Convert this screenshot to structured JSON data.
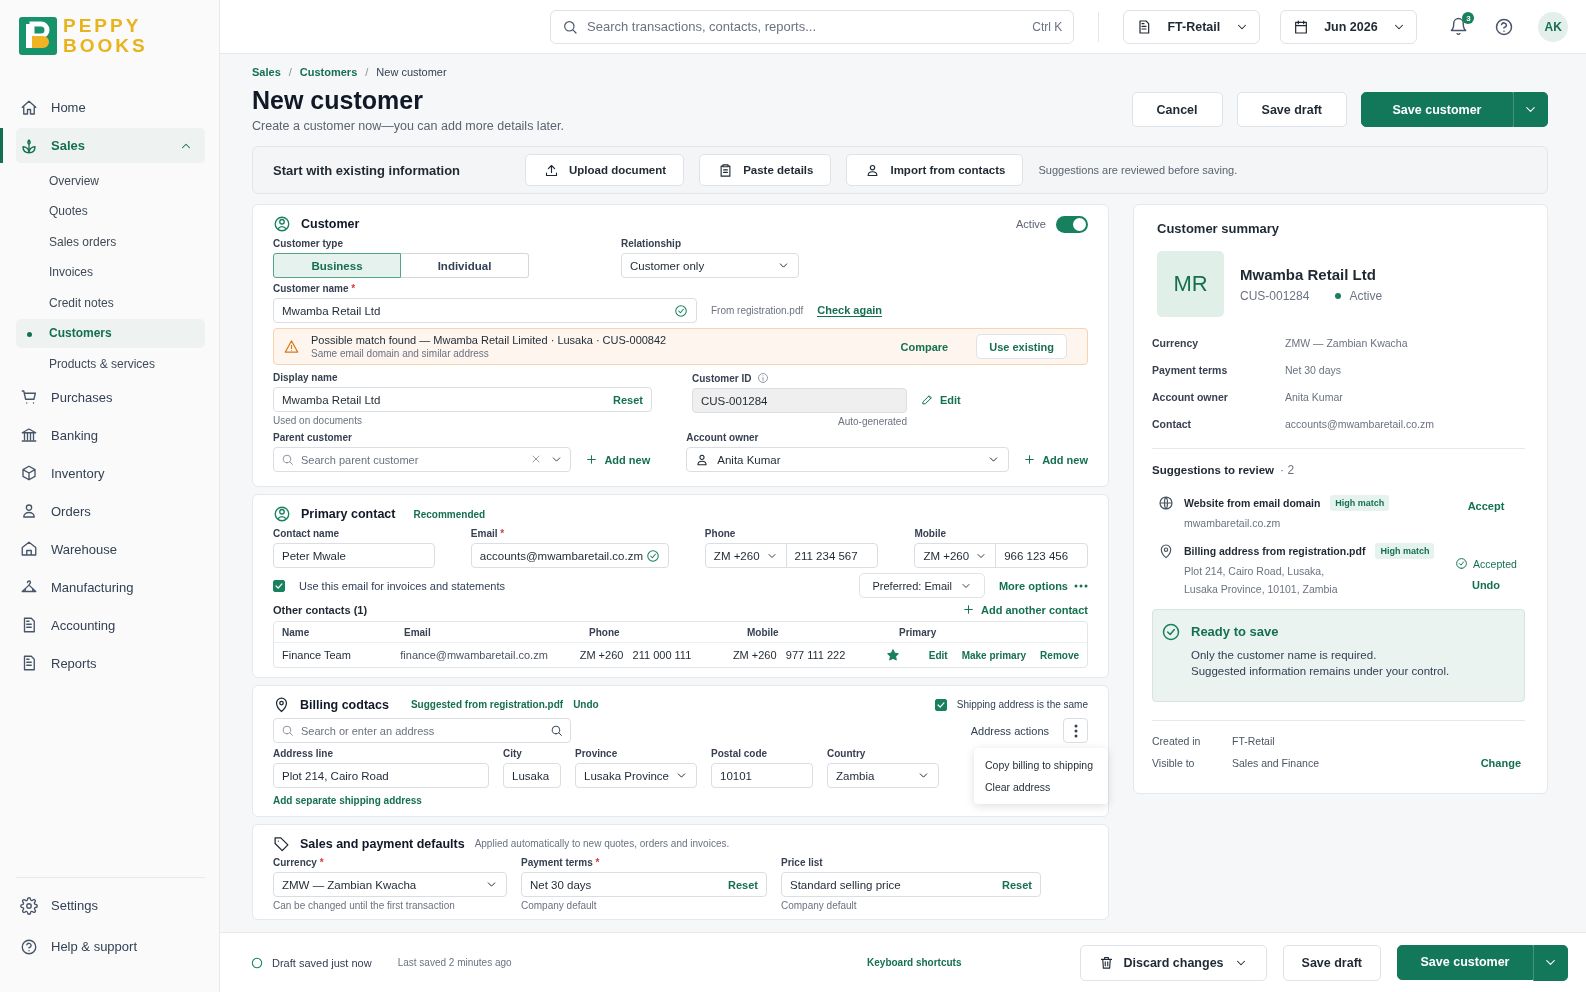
{
  "brand": {
    "lines": [
      "PEPPY",
      "BOOKS"
    ]
  },
  "sidebar": {
    "items": [
      {
        "label": "Home",
        "selected": false
      },
      {
        "label": "Sales",
        "selected": true,
        "expanded": true,
        "children": [
          {
            "label": "Overview",
            "selected": false
          },
          {
            "label": "Quotes",
            "selected": false
          },
          {
            "label": "Sales orders",
            "selected": false
          },
          {
            "label": "Invoices",
            "selected": false
          },
          {
            "label": "Credit notes",
            "selected": false
          },
          {
            "label": "Customers",
            "selected": true
          },
          {
            "label": "Products & services",
            "selected": false
          }
        ]
      },
      {
        "label": "Purchases",
        "selected": false
      },
      {
        "label": "Banking",
        "selected": false
      },
      {
        "label": "Inventory",
        "selected": false
      },
      {
        "label": "Orders",
        "selected": false
      },
      {
        "label": "Warehouse",
        "selected": false
      },
      {
        "label": "Manufacturing",
        "selected": false
      },
      {
        "label": "Accounting",
        "selected": false
      },
      {
        "label": "Reports",
        "selected": false
      }
    ],
    "footer_items": [
      {
        "label": "Settings"
      },
      {
        "label": "Help & support"
      }
    ]
  },
  "topbar": {
    "search_placeholder": "Search transactions, contacts, reports...",
    "shortcut": "Ctrl K",
    "organization": "FT-Retail",
    "period": "Jun 2026",
    "notification_count": "3",
    "avatar": "AK"
  },
  "breadcrumb": {
    "separator": "/",
    "items": [
      "Sales",
      "Customers",
      "New customer"
    ]
  },
  "page": {
    "title": "New customer",
    "subtitle": "Create a customer now—you can add more details later.",
    "actions": {
      "cancel": "Cancel",
      "save_draft": "Save draft",
      "save": "Save customer"
    }
  },
  "import_bar": {
    "title": "Start with existing information",
    "buttons": [
      "Upload document",
      "Paste details",
      "Import from contacts"
    ],
    "note": "Suggestions are reviewed before saving."
  },
  "customer": {
    "title": "Customer",
    "active": {
      "label": "Active",
      "on": true
    },
    "customer_type": {
      "label": "Customer type",
      "options": [
        {
          "label": "Business",
          "selected": true
        },
        {
          "label": "Individual",
          "selected": false
        }
      ]
    },
    "relationship": {
      "label": "Relationship",
      "value": "Customer only"
    },
    "customer_name": {
      "label": "Customer name",
      "required_mark": "*",
      "value": "Mwamba Retail Ltd",
      "verified": true,
      "source": "From registration.pdf",
      "action": "Check again"
    },
    "match_alert": {
      "title": "Possible match found — Mwamba Retail Limited · Lusaka · CUS-000842",
      "detail": "Same email domain and similar address",
      "actions": [
        "Compare",
        "Use existing"
      ]
    },
    "display_name": {
      "label": "Display name",
      "value": "Mwamba Retail Ltd",
      "action": "Reset",
      "hint": "Used on documents"
    },
    "customer_id": {
      "label": "Customer ID",
      "value": "CUS-001284",
      "action": "Edit",
      "hint": "Auto-generated"
    },
    "parent_customer": {
      "label": "Parent customer",
      "placeholder": "Search parent customer",
      "action": "Add new"
    },
    "account_owner": {
      "label": "Account owner",
      "value": "Anita Kumar",
      "action": "Add new"
    }
  },
  "primary_contact": {
    "title": "Primary contact",
    "badge": "Recommended",
    "contact_name": {
      "label": "Contact name",
      "value": "Peter Mwale"
    },
    "email": {
      "label": "Email",
      "required_mark": "*",
      "value": "accounts@mwambaretail.co.zm",
      "verified": true
    },
    "phone": {
      "label": "Phone",
      "code": "ZM +260",
      "value": "211 234 567"
    },
    "mobile": {
      "label": "Mobile",
      "code": "ZM +260",
      "value": "966 123 456"
    },
    "use_for_invoices": {
      "label": "Use this email for invoices and statements",
      "checked": true
    },
    "preferred": "Preferred: Email",
    "more_options": "More options",
    "other_contacts": {
      "title": "Other contacts (1)",
      "add": "Add another contact",
      "columns": [
        "Name",
        "Email",
        "Phone",
        "Mobile",
        "Primary"
      ],
      "rows": [
        {
          "name": "Finance Team",
          "email": "finance@mwambaretail.co.zm",
          "phone_code": "ZM +260",
          "phone": "211 000 111",
          "mobile_code": "ZM +260",
          "mobile": "977 111 222",
          "primary": true,
          "actions": [
            "Edit",
            "Make primary",
            "Remove"
          ]
        }
      ]
    }
  },
  "billing": {
    "title": "Billing codtacs",
    "source": "Suggested from registration.pdf",
    "undo": "Undo",
    "shipping_same": {
      "label": "Shipping address is the same",
      "checked": true
    },
    "search_placeholder": "Search or enter an address",
    "actions_label": "Address actions",
    "menu": [
      "Copy billing to shipping",
      "Clear address"
    ],
    "fields": [
      {
        "label": "Address line",
        "value": "Plot 214, Cairo Road",
        "kind": "text"
      },
      {
        "label": "City",
        "value": "Lusaka",
        "kind": "text"
      },
      {
        "label": "Province",
        "value": "Lusaka Province",
        "kind": "select"
      },
      {
        "label": "Postal code",
        "value": "10101",
        "kind": "text"
      },
      {
        "label": "Country",
        "value": "Zambia",
        "kind": "select"
      }
    ],
    "add_shipping": "Add separate shipping address"
  },
  "defaults": {
    "title": "Sales and payment defaults",
    "note": "Applied automatically to new quotes, orders and invoices.",
    "fields": [
      {
        "label": "Currency",
        "required_mark": "*",
        "value": "ZMW — Zambian Kwacha",
        "kind": "select",
        "hint": "Can be changed until the first transaction"
      },
      {
        "label": "Payment terms",
        "required_mark": "*",
        "value": "Net 30 days",
        "kind": "text",
        "action": "Reset",
        "hint": "Company default"
      },
      {
        "label": "Price list",
        "value": "Standard selling price",
        "kind": "text",
        "action": "Reset",
        "hint": "Company default"
      }
    ]
  },
  "summary": {
    "title": "Customer summary",
    "initials": "MR",
    "name": "Mwamba Retail Ltd",
    "id": "CUS-001284",
    "status": {
      "label": "Active",
      "color": "#1a7f5c"
    },
    "details": [
      {
        "label": "Currency",
        "value": "ZMW — Zambian Kwacha"
      },
      {
        "label": "Payment terms",
        "value": "Net 30 days"
      },
      {
        "label": "Account owner",
        "value": "Anita Kumar"
      },
      {
        "label": "Contact",
        "value": "accounts@mwambaretail.co.zm"
      }
    ],
    "suggestions": {
      "title": "Suggestions to review",
      "count": "· 2",
      "items": [
        {
          "title": "Website from email domain",
          "badge": "High match",
          "lines": [
            "mwambaretail.co.zm"
          ],
          "accepted": false,
          "action": "Accept"
        },
        {
          "title": "Billing address from registration.pdf",
          "badge": "High match",
          "lines": [
            "Plot 214, Cairo Road, Lusaka,",
            "Lusaka Province, 10101, Zambia"
          ],
          "accepted": true,
          "accepted_label": "Accepted",
          "action": "Undo"
        }
      ]
    },
    "ready": {
      "title": "Ready to save",
      "lines": [
        "Only the customer name is required.",
        "Suggested information remains under your control."
      ]
    },
    "meta": [
      {
        "label": "Created in",
        "value": "FT-Retail"
      },
      {
        "label": "Visible to",
        "value": "Sales and Finance",
        "action": "Change"
      }
    ]
  },
  "footer": {
    "draft_status": "Draft saved just now",
    "last_saved": "Last saved 2 minutes ago",
    "shortcuts": "Keyboard shortcuts",
    "discard": "Discard changes",
    "save_draft": "Save draft",
    "save": "Save customer"
  }
}
